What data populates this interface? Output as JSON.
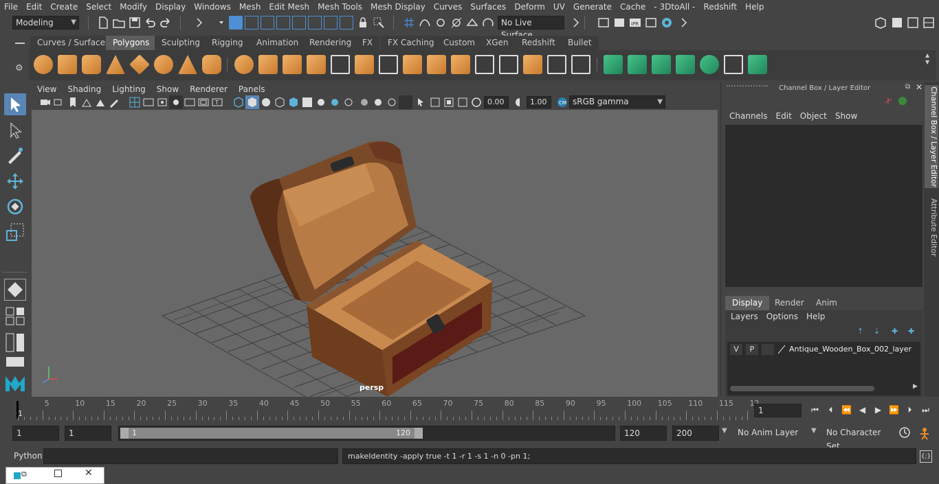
{
  "menus": [
    "File",
    "Edit",
    "Create",
    "Select",
    "Modify",
    "Display",
    "Windows",
    "Mesh",
    "Edit Mesh",
    "Mesh Tools",
    "Mesh Display",
    "Curves",
    "Surfaces",
    "Deform",
    "UV",
    "Generate",
    "Cache",
    "- 3DtoAll -",
    "Redshift",
    "Help"
  ],
  "status": {
    "mode": "Modeling",
    "live_surface": "No Live Surface"
  },
  "shelf_tabs": [
    "Curves / Surfaces",
    "Polygons",
    "Sculpting",
    "Rigging",
    "Animation",
    "Rendering",
    "FX",
    "FX Caching",
    "Custom",
    "XGen",
    "Redshift",
    "Bullet"
  ],
  "shelf_active": "Polygons",
  "panel_menus": [
    "View",
    "Shading",
    "Lighting",
    "Show",
    "Renderer",
    "Panels"
  ],
  "viewport": {
    "exposure": "0.00",
    "gamma": "1.00",
    "color_space": "sRGB gamma",
    "camera_label": "persp"
  },
  "channel_box": {
    "title": "Channel Box / Layer Editor",
    "menus": [
      "Channels",
      "Edit",
      "Object",
      "Show"
    ],
    "layer_tabs": [
      "Display",
      "Render",
      "Anim"
    ],
    "layer_menus": [
      "Layers",
      "Options",
      "Help"
    ],
    "layer": {
      "v": "V",
      "p": "P",
      "name": "Antique_Wooden_Box_002_layer"
    },
    "side_tabs": [
      "Channel Box / Layer Editor",
      "Attribute Editor"
    ]
  },
  "timeline": {
    "ticks": [
      "5",
      "10",
      "15",
      "20",
      "25",
      "30",
      "35",
      "40",
      "45",
      "50",
      "55",
      "60",
      "65",
      "70",
      "75",
      "80",
      "85",
      "90",
      "95",
      "100",
      "105",
      "110",
      "115",
      "12"
    ],
    "start_marker": "1",
    "current_frame": "1"
  },
  "range": {
    "start": "1",
    "start2": "1",
    "range_start": "1",
    "range_end_inner": "120",
    "range_end": "120",
    "anim_end": "200",
    "anim_layer": "No Anim Layer",
    "char_set": "No Character Set"
  },
  "cmdline": {
    "lang": "Python",
    "result": "makeIdentity -apply true -t 1 -r 1 -s 1 -n 0 -pn 1;"
  }
}
